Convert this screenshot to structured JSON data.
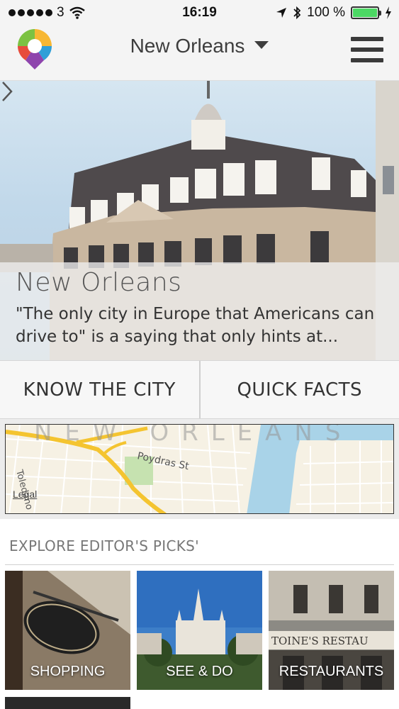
{
  "status_bar": {
    "carrier": "3",
    "time": "16:19",
    "battery_percent": "100 %",
    "battery_level": 1.0
  },
  "header": {
    "selected_city": "New Orleans",
    "logo_icon": "map-pin-logo-icon",
    "menu_icon": "hamburger-menu-icon"
  },
  "hero": {
    "title": "New Orleans",
    "description": "\"The only city in Europe that Americans can drive to\" is a saying that only hints at..."
  },
  "actions": {
    "know_the_city": "KNOW THE CITY",
    "quick_facts": "QUICK FACTS"
  },
  "map": {
    "city_watermark": "NEW ORLEANS",
    "street_label": "Poydras St",
    "street_label_2": "Toledano",
    "legal_link": "Legal"
  },
  "picks": {
    "title": "EXPLORE EDITOR'S PICKS'",
    "tiles": [
      {
        "label": "SHOPPING"
      },
      {
        "label": "SEE & DO"
      },
      {
        "label": "RESTAURANTS"
      }
    ]
  },
  "colors": {
    "battery": "#4cd964",
    "header_bg": "#f4f4f4",
    "map_water": "#a9d3e8",
    "map_highway": "#f4c430"
  }
}
